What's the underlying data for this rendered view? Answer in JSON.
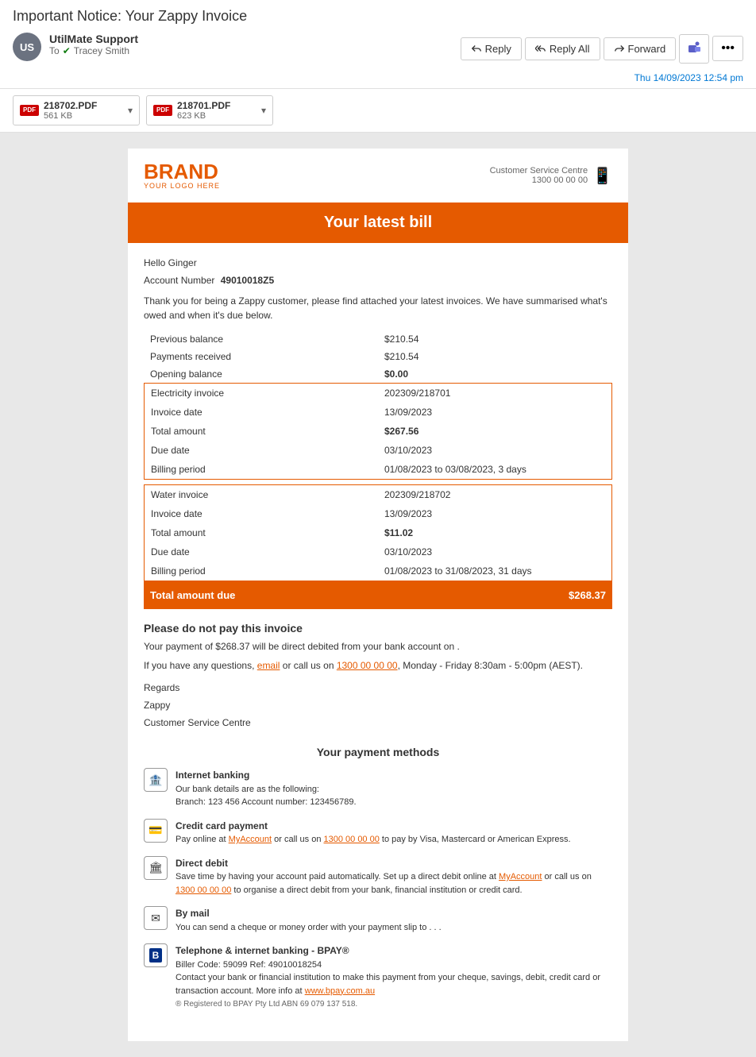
{
  "subject": "Important Notice: Your Zappy Invoice",
  "actions": {
    "reply": "Reply",
    "replyAll": "Reply All",
    "forward": "Forward",
    "more": "..."
  },
  "sender": {
    "initials": "US",
    "name": "UtilMate Support",
    "to_label": "To",
    "recipient": "Tracey Smith",
    "timestamp": "Thu 14/09/2023 12:54 pm"
  },
  "attachments": [
    {
      "name": "218702.PDF",
      "size": "561 KB"
    },
    {
      "name": "218701.PDF",
      "size": "623 KB"
    }
  ],
  "invoice": {
    "brand_name": "BRAND",
    "brand_sub": "YOUR LOGO HERE",
    "customer_service_label": "Customer Service Centre",
    "customer_service_phone": "1300 00 00 00",
    "bill_header": "Your latest bill",
    "greeting": "Hello Ginger",
    "account_label": "Account Number",
    "account_number": "49010018Z5",
    "intro_text": "Thank you for being a Zappy customer, please find attached your latest invoices. We have summarised what's owed and when it's due below.",
    "table": {
      "previous_balance_label": "Previous balance",
      "previous_balance_value": "$210.54",
      "payments_received_label": "Payments received",
      "payments_received_value": "$210.54",
      "opening_balance_label": "Opening balance",
      "opening_balance_value": "$0.00",
      "electricity_section": {
        "invoice_label": "Electricity invoice",
        "invoice_value": "202309/218701",
        "date_label": "Invoice date",
        "date_value": "13/09/2023",
        "total_label": "Total amount",
        "total_value": "$267.56",
        "due_label": "Due date",
        "due_value": "03/10/2023",
        "period_label": "Billing period",
        "period_value": "01/08/2023 to 03/08/2023, 3 days"
      },
      "water_section": {
        "invoice_label": "Water invoice",
        "invoice_value": "202309/218702",
        "date_label": "Invoice date",
        "date_value": "13/09/2023",
        "total_label": "Total amount",
        "total_value": "$11.02",
        "due_label": "Due date",
        "due_value": "03/10/2023",
        "period_label": "Billing period",
        "period_value": "01/08/2023 to 31/08/2023, 31 days"
      },
      "total_due_label": "Total amount due",
      "total_due_value": "$268.37"
    },
    "no_pay_heading": "Please do not pay this invoice",
    "no_pay_text": "Your payment of $268.37 will be direct debited from your bank account on .",
    "question_text": "If you have any questions, email or call us on 1300 00 00 00, Monday - Friday 8:30am - 5:00pm (AEST).",
    "regards_label": "Regards",
    "company_name": "Zappy",
    "company_dept": "Customer Service Centre",
    "payment_methods_heading": "Your payment methods",
    "payment_methods": [
      {
        "icon": "🏦",
        "title": "Internet banking",
        "text": "Our bank details are as the following:",
        "details": "Branch: 123 456 Account number: 123456789."
      },
      {
        "icon": "💳",
        "title": "Credit card payment",
        "text": "Pay online at MyAccount or call us on 1300 00 00 00 to pay by Visa, Mastercard or American Express."
      },
      {
        "icon": "🏛",
        "title": "Direct debit",
        "text": "Save time by having your account paid automatically. Set up a direct debit online at MyAccount or call us on 1300 00 00 00 to organise a direct debit from your bank, financial institution or credit card."
      },
      {
        "icon": "✉",
        "title": "By mail",
        "text": "You can send a cheque or money order with your payment slip to . . ."
      },
      {
        "icon": "B",
        "title": "Telephone & internet banking - BPAY®",
        "text": "Biller Code: 59099 Ref: 49010018254",
        "details": "Contact your bank or financial institution to make this payment from your cheque, savings, debit, credit card or transaction account. More info at www.bpay.com.au",
        "legal": "® Registered to BPAY Pty Ltd ABN 69 079 137 518."
      }
    ]
  }
}
